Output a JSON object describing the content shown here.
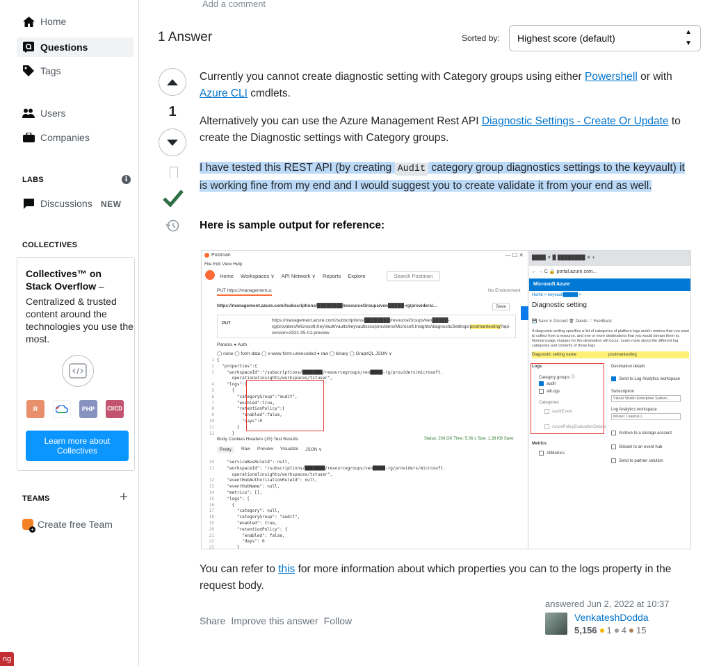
{
  "sidebar": {
    "nav": [
      {
        "label": "Home",
        "icon": "home-icon"
      },
      {
        "label": "Questions",
        "icon": "questions-icon"
      },
      {
        "label": "Tags",
        "icon": "tag-icon"
      },
      {
        "label": "Users",
        "icon": "users-icon"
      },
      {
        "label": "Companies",
        "icon": "briefcase-icon"
      }
    ],
    "labs_heading": "LABS",
    "discussions_label": "Discussions",
    "discussions_badge": "NEW",
    "collectives_heading": "COLLECTIVES",
    "collectives_title": "Collectives™ on Stack Overflow",
    "collectives_title_suffix": " –",
    "collectives_desc": "Centralized & trusted content around the technologies you use the most.",
    "collective_tags": [
      {
        "label": "R",
        "color": "#e8906b"
      },
      {
        "label": "",
        "color": "#ffffff"
      },
      {
        "label": "PHP",
        "color": "#8892bf"
      },
      {
        "label": "CI/CD",
        "color": "#c25470"
      }
    ],
    "learn_more": "Learn more about Collectives",
    "teams_heading": "TEAMS",
    "create_team": "Create free Team",
    "hiring_badge": "ng"
  },
  "question": {
    "add_comment": "Add a comment"
  },
  "answers_header": {
    "title": "1 Answer",
    "sorted_by": "Sorted by:",
    "sort_value": "Highest score (default)"
  },
  "answer": {
    "score": "1",
    "p1_a": "Currently you cannot create diagnostic setting with Category groups using either ",
    "p1_link1": "Powershell",
    "p1_b": " or with ",
    "p1_link2": "Azure CLI",
    "p1_c": " cmdlets.",
    "p2_a": "Alternatively you can use the Azure Management Rest API ",
    "p2_link": "Diagnostic Settings - Create Or Update",
    "p2_b": " to create the Diagnostic settings with Category groups.",
    "p3_a": "I have tested this REST API (by creating ",
    "p3_code": "Audit",
    "p3_b": " category group diagnostics settings to the keyvault) it is working fine from my end and I would suggest you to create validate it from your end as well.",
    "heading": "Here is sample output for reference:",
    "p4_a": "You can refer to ",
    "p4_link": "this",
    "p4_b": " for more information about which properties you can to the logs property in the request body.",
    "actions": [
      "Share",
      "Improve this answer",
      "Follow"
    ],
    "answered": "answered Jun 2, 2022 at 10:37",
    "user_name": "VenkateshDodda",
    "reputation": "5,156",
    "gold": "1",
    "silver": "4",
    "bronze": "15"
  },
  "screenshot": {
    "pm_title": "Postman",
    "pm_menu": "File  Edit  View  Help",
    "pm_nav": [
      "Home",
      "Workspaces ∨",
      "API Network ∨",
      "Reports",
      "Explore"
    ],
    "pm_search": "Search Postman",
    "pm_tab": "PUT https://management.a:",
    "pm_env": "No Environment",
    "pm_url": "https://management.azure.com//subscriptions/████████/resourceGroups/ven█████-rg/providers/...",
    "pm_save": "Save",
    "pm_method": "PUT",
    "pm_put_url_a": "https://management.azure.com//subscriptions/████████/resourceGroups/ven█████-rg/providers/Microsoft.KeyVault/vaults/keyvaultxxxx/providers/Microsoft.Insights/diagnosticSettings/",
    "pm_put_url_hl": "postmantesting",
    "pm_put_url_b": "?api-version=2021-05-01-preview",
    "pm_params": "Params ●   Auth",
    "pm_body_types": "◯ none  ◯ form-data  ◯ x-www-form-urlencoded  ● raw  ◯ binary  ◯ GraphQL   JSON ∨",
    "pm_lines_top": "1\n2\n3\n\n4\n5\n6\n7\n8\n9\n10\n11\n12",
    "pm_code_top": "{\n  \"properties\":{\n    \"workspaceId\":\"/subscriptions/████████/resourcegroups/ven█████-rg/providers/microsoft.\n      operationalinsights/workspaces/tstuser\",\n    \"logs\":[\n      {\n        \"categoryGroup\":\"audit\",\n        \"enabled\":true,\n        \"retentionPolicy\":{\n          \"enabled\":false,\n          \"days\":0\n        }\n      }",
    "pm_resp_tabs": "Body  Cookies  Headers (15)  Test Results",
    "pm_status": "Status: 200 OK   Time: 5.06 s   Size: 1.38 KB   Save",
    "pm_pretty": [
      "Pretty",
      "Raw",
      "Preview",
      "Visualize",
      "JSON ∨"
    ],
    "pm_lines_bot": "10\n11\n\n12\n13\n14\n15\n16\n17\n18\n19\n20\n21\n22\n23",
    "pm_code_bot": "    \"serviceBusRuleId\": null,\n    \"workspaceId\": \"/subscriptions/████████/resourcegroups/ven█████-rg/providers/microsoft.\n      operationalinsights/workspaces/tstuser\",\n    \"eventHubAuthorizationRuleId\": null,\n    \"eventHubName\": null,\n    \"metrics\": [],\n    \"logs\": [\n      {\n        \"category\": null,\n        \"categoryGroup\": \"audit\",\n        \"enabled\": true,\n        \"retentionPolicy\": {\n          \"enabled\": false,\n          \"days\": 0\n        }",
    "az_tabs": "████ ✕ ▉ ████████ ✕  +",
    "az_address": "← → C  🔒 portal.azure.com...",
    "az_brand": "Microsoft Azure",
    "az_breadcrumb": "Home > keyvault█████ >",
    "az_title": "Diagnostic setting",
    "az_toolbar": "💾 Save  ✕ Discard  🗑 Delete  ♡ Feedback",
    "az_desc": "A diagnostic setting specifies a list of categories of platform logs and/or metrics that you want to collect from a resource, and one or more destinations that you would stream them to. Normal usage charges for the destination will occur. Learn more about the different log categories and contents of those logs",
    "az_name_label": "Diagnostic setting name",
    "az_name_value": "postmantesting",
    "az_logs": "Logs",
    "az_dest": "Destination details",
    "az_cat_groups": "Category groups ⓘ",
    "az_audit": "audit",
    "az_alllogs": "allLogs",
    "az_categories": "Categories",
    "az_auditevent": "AuditEvent",
    "az_policy": "AzurePolicyEvaluationDetails",
    "az_send_la": "Send to Log Analytics workspace",
    "az_subscription": "Subscription",
    "az_sub_value": "Visual Studio Enterprise Subscr...",
    "az_law": "Log Analytics workspace",
    "az_law_value": "tstuser ( eastus )",
    "az_archive": "Archive to a storage account",
    "az_stream": "Stream to an event hub",
    "az_partner": "Send to partner solution",
    "az_metrics": "Metrics",
    "az_allmetrics": "AllMetrics"
  },
  "colors": {
    "accent": "#0a95ff",
    "link": "#0074cc",
    "accepted": "#2f6f44",
    "selection": "#bcdaf8"
  }
}
